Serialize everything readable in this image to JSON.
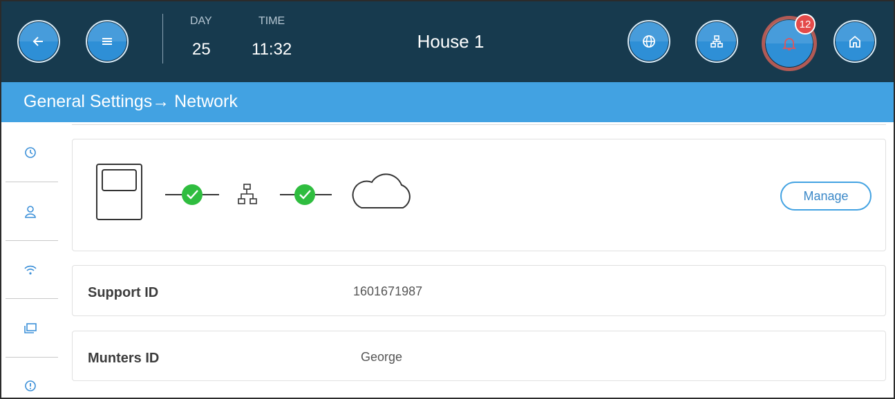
{
  "header": {
    "day_label": "DAY",
    "day_value": "25",
    "time_label": "TIME",
    "time_value": "11:32",
    "house_title": "House 1",
    "alarm_count": "12",
    "buttons": [
      "back-icon",
      "menu-icon",
      "globe-icon",
      "network-icon",
      "bell-icon",
      "home-icon"
    ]
  },
  "breadcrumb": {
    "text": "General Settings→ Network"
  },
  "sidebar": {
    "items": [
      "clock-icon",
      "user-icon",
      "wifi-icon",
      "folder-icon",
      "alert-icon"
    ]
  },
  "network": {
    "status_icons": [
      "controller-icon",
      "check-icon",
      "network-icon",
      "check-icon",
      "cloud-icon"
    ],
    "manage_label": "Manage"
  },
  "rows": {
    "support_label": "Support ID",
    "support_value": "1601671987",
    "munters_label": "Munters ID",
    "munters_value": "George"
  },
  "colors": {
    "topbar": "#173a4e",
    "breadcrumb": "#42a2e2",
    "button": "#2e8fd6",
    "check": "#2fbd3f",
    "badge": "#e44a4a"
  }
}
